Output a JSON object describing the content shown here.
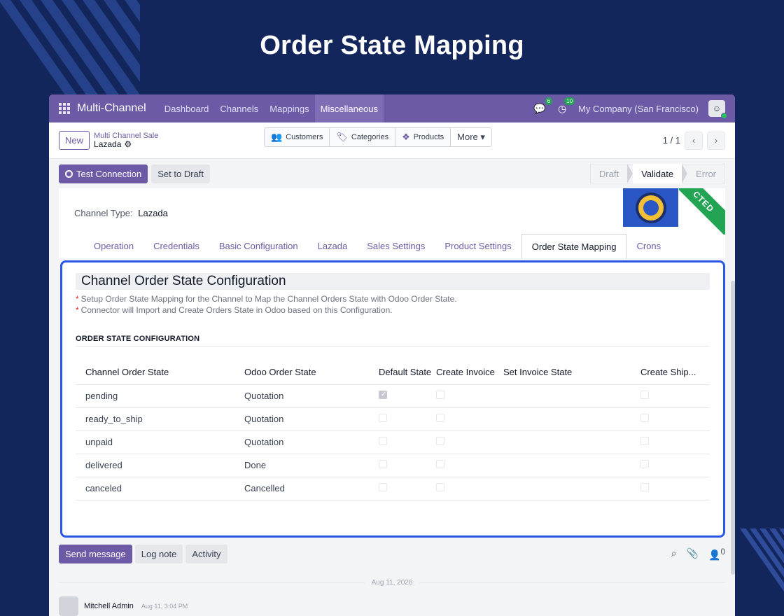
{
  "hero": {
    "title": "Order State Mapping"
  },
  "navbar": {
    "brand": "Multi-Channel",
    "items": [
      "Dashboard",
      "Channels",
      "Mappings",
      "Miscellaneous"
    ],
    "active_item": "Miscellaneous",
    "messages_count": "6",
    "activities_count": "10",
    "company": "My Company (San Francisco)"
  },
  "control": {
    "new_label": "New",
    "breadcrumb_parent": "Multi Channel Sale",
    "breadcrumb_current": "Lazada",
    "smart_buttons": [
      "Customers",
      "Categories",
      "Products"
    ],
    "more_label": "More ▾",
    "pager": "1 / 1"
  },
  "statusbar": {
    "test_connection": "Test Connection",
    "set_to_draft": "Set to Draft",
    "stages": [
      "Draft",
      "Validate",
      "Error"
    ],
    "active_stage": "Validate"
  },
  "sheet": {
    "channel_type_label": "Channel Type:",
    "channel_type_value": "Lazada",
    "ribbon": "CTED",
    "tabs": [
      "Operation",
      "Credentials",
      "Basic Configuration",
      "Lazada",
      "Sales Settings",
      "Product Settings",
      "Order State Mapping",
      "Crons"
    ],
    "active_tab": "Order State Mapping"
  },
  "panel": {
    "title": "Channel Order State Configuration",
    "notes": [
      "Setup Order State Mapping for the Channel to Map the Channel Orders State with Odoo Order State.",
      "Connector will Import and Create Orders State in Odoo based on this Configuration."
    ],
    "subtitle": "ORDER STATE CONFIGURATION",
    "columns": [
      "Channel Order State",
      "Odoo Order State",
      "Default State",
      "Create Invoice",
      "Set Invoice State",
      "Create Ship..."
    ],
    "rows": [
      {
        "channel_state": "pending",
        "odoo_state": "Quotation",
        "default": true
      },
      {
        "channel_state": "ready_to_ship",
        "odoo_state": "Quotation",
        "default": false
      },
      {
        "channel_state": "unpaid",
        "odoo_state": "Quotation",
        "default": false
      },
      {
        "channel_state": "delivered",
        "odoo_state": "Done",
        "default": false
      },
      {
        "channel_state": "canceled",
        "odoo_state": "Cancelled",
        "default": false
      }
    ]
  },
  "chatter": {
    "send_message": "Send message",
    "log_note": "Log note",
    "activity": "Activity",
    "followers_count": "0",
    "date": "Aug 11, 2026",
    "author": "Mitchell Admin",
    "time": "Aug 11, 3:04 PM"
  },
  "colors": {
    "accent": "#6c5aa6",
    "highlight": "#2b57e6",
    "background": "#13265c",
    "ribbon": "#23a455"
  }
}
